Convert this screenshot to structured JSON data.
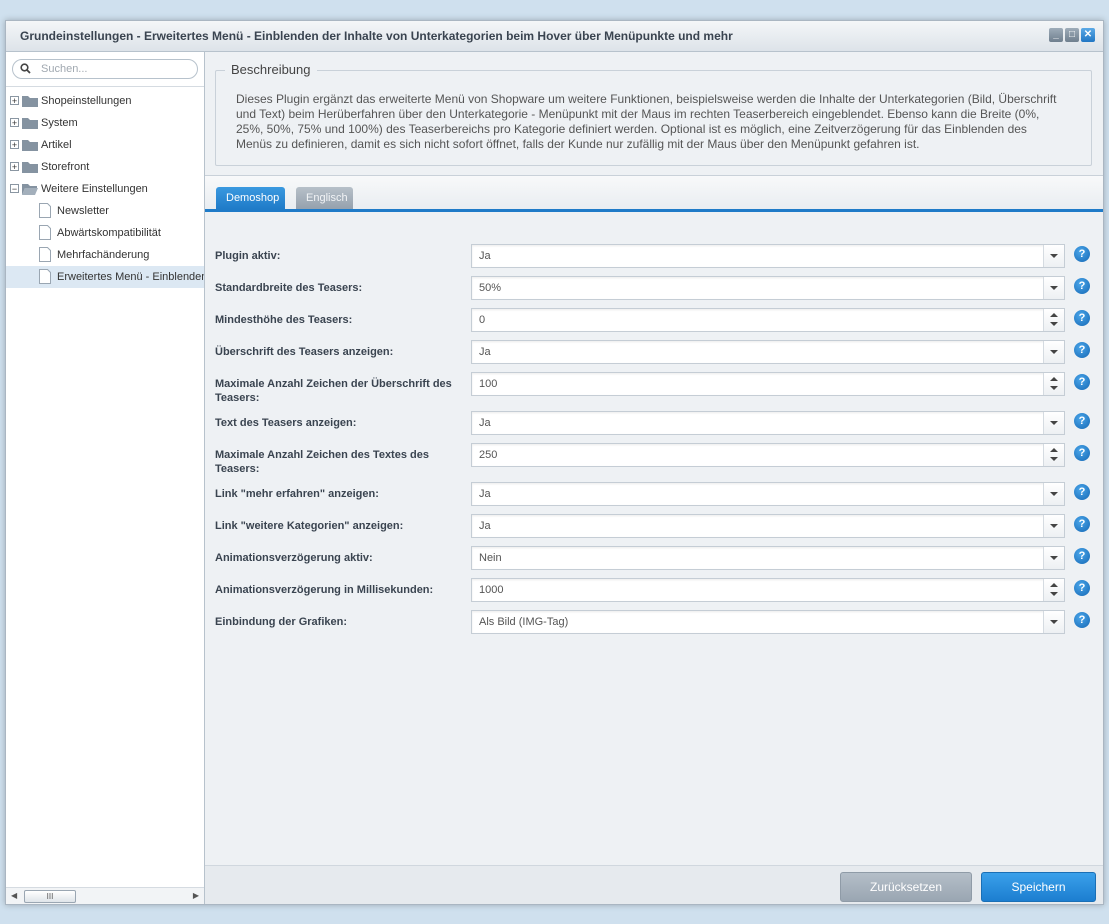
{
  "window": {
    "title": "Grundeinstellungen - Erweitertes Menü - Einblenden der Inhalte von Unterkategorien beim Hover über Menüpunkte und mehr"
  },
  "sidebar": {
    "search_placeholder": "Suchen...",
    "tree": [
      {
        "label": "Shopeinstellungen",
        "expander": "+"
      },
      {
        "label": "System",
        "expander": "+"
      },
      {
        "label": "Artikel",
        "expander": "+"
      },
      {
        "label": "Storefront",
        "expander": "+"
      },
      {
        "label": "Weitere Einstellungen",
        "expander": "−"
      },
      {
        "label": "Newsletter"
      },
      {
        "label": "Abwärtskompatibilität"
      },
      {
        "label": "Mehrfachänderung"
      },
      {
        "label": "Erweitertes Menü - Einblenden"
      }
    ],
    "scroll_thumb": "III"
  },
  "description": {
    "legend": "Beschreibung",
    "text": "Dieses Plugin ergänzt das erweiterte Menü von Shopware um weitere Funktionen, beispielsweise werden die Inhalte der Unterkategorien (Bild, Überschrift und Text) beim Herüberfahren über den Unterkategorie - Menüpunkt mit der Maus im rechten Teaserbereich eingeblendet. Ebenso kann die Breite (0%, 25%, 50%, 75% und 100%) des Teaserbereichs pro Kategorie definiert werden. Optional ist es möglich, eine Zeitverzögerung für das Einblenden des Menüs zu definieren, damit es sich nicht sofort öffnet, falls der Kunde nur zufällig mit der Maus über den Menüpunkt gefahren ist."
  },
  "tabs": [
    {
      "label": "Demoshop",
      "active": true
    },
    {
      "label": "Englisch",
      "active": false
    }
  ],
  "fields": [
    {
      "label": "Plugin aktiv:",
      "value": "Ja",
      "type": "select"
    },
    {
      "label": "Standardbreite des Teasers:",
      "value": "50%",
      "type": "select"
    },
    {
      "label": "Mindesthöhe des Teasers:",
      "value": "0",
      "type": "number"
    },
    {
      "label": "Überschrift des Teasers anzeigen:",
      "value": "Ja",
      "type": "select"
    },
    {
      "label": "Maximale Anzahl Zeichen der Überschrift des Teasers:",
      "value": "100",
      "type": "number"
    },
    {
      "label": "Text des Teasers anzeigen:",
      "value": "Ja",
      "type": "select"
    },
    {
      "label": "Maximale Anzahl Zeichen des Textes des Teasers:",
      "value": "250",
      "type": "number"
    },
    {
      "label": "Link \"mehr erfahren\" anzeigen:",
      "value": "Ja",
      "type": "select"
    },
    {
      "label": "Link \"weitere Kategorien\" anzeigen:",
      "value": "Ja",
      "type": "select"
    },
    {
      "label": "Animationsverzögerung aktiv:",
      "value": "Nein",
      "type": "select"
    },
    {
      "label": "Animationsverzögerung in Millisekunden:",
      "value": "1000",
      "type": "number"
    },
    {
      "label": "Einbindung der Grafiken:",
      "value": "Als Bild (IMG-Tag)",
      "type": "select"
    }
  ],
  "help_glyph": "?",
  "footer": {
    "reset_label": "Zurücksetzen",
    "save_label": "Speichern"
  },
  "colors": {
    "accent": "#1f7bc8",
    "save_button": "#2a8fde",
    "reset_button": "#a7b2bd"
  }
}
